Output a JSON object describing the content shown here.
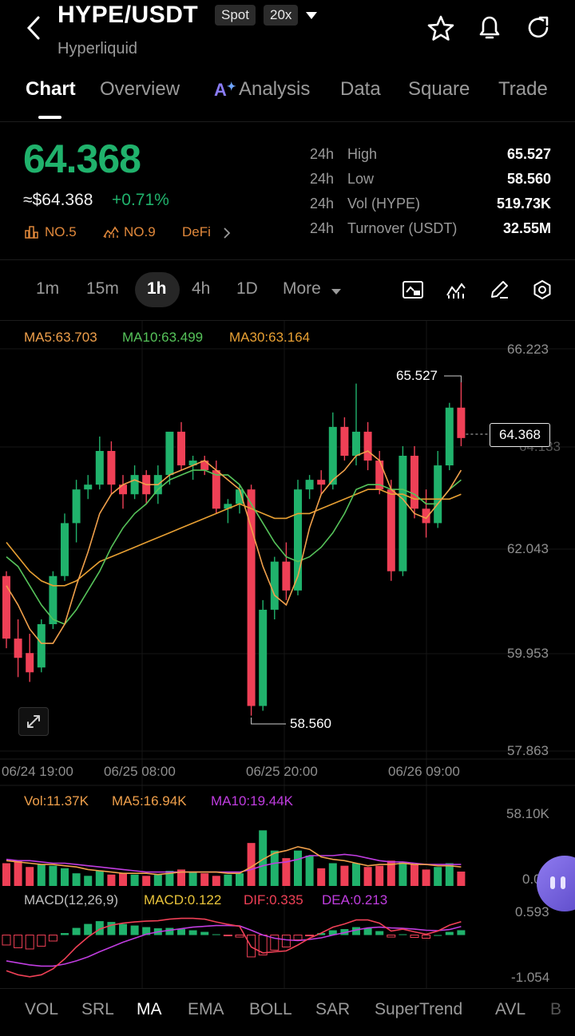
{
  "header": {
    "title": "HYPE/USDT",
    "spot_badge": "Spot",
    "leverage_badge": "20x",
    "subtitle": "Hyperliquid"
  },
  "tabs": [
    {
      "label": "Chart"
    },
    {
      "label": "Overview"
    },
    {
      "label": "Analysis"
    },
    {
      "label": "Data"
    },
    {
      "label": "Square"
    },
    {
      "label": "Trade"
    }
  ],
  "ticker": {
    "price": "64.368",
    "approx": "≈$64.368",
    "change": "+0.71%",
    "rank1": "NO.5",
    "rank2": "NO.9",
    "category": "DeFi",
    "stats": [
      {
        "period": "24h",
        "label": "High",
        "value": "65.527"
      },
      {
        "period": "24h",
        "label": "Low",
        "value": "58.560"
      },
      {
        "period": "24h",
        "label": "Vol (HYPE)",
        "value": "519.73K"
      },
      {
        "period": "24h",
        "label": "Turnover (USDT)",
        "value": "32.55M"
      }
    ]
  },
  "timeframes": [
    {
      "label": "1m"
    },
    {
      "label": "15m"
    },
    {
      "label": "1h"
    },
    {
      "label": "4h"
    },
    {
      "label": "1D"
    },
    {
      "label": "More"
    }
  ],
  "ma_legend": {
    "ma5": "MA5:63.703",
    "ma10": "MA10:63.499",
    "ma30": "MA30:63.164"
  },
  "price_axis": [
    "66.223",
    "62.043",
    "59.953",
    "57.863"
  ],
  "time_axis": [
    "06/24 19:00",
    "06/25 08:00",
    "06/25 20:00",
    "06/26 09:00"
  ],
  "annotations": {
    "high": "65.527",
    "low": "58.560",
    "current": "64.368",
    "hidden_tick": "64.133"
  },
  "vol_legend": {
    "vol": "Vol:11.37K",
    "ma5": "MA5:16.94K",
    "ma10": "MA10:19.44K"
  },
  "vol_axis": {
    "top": "58.10K",
    "bottom": "0.00"
  },
  "macd_legend": {
    "name": "MACD(12,26,9)",
    "macd": "MACD:0.122",
    "dif": "DIF:0.335",
    "dea": "DEA:0.213"
  },
  "macd_axis": {
    "top": "0.593",
    "bottom": "-1.054"
  },
  "indicator_tabs": [
    {
      "label": "VOL"
    },
    {
      "label": "SRL"
    },
    {
      "label": "MA"
    },
    {
      "label": "EMA"
    },
    {
      "label": "BOLL"
    },
    {
      "label": "SAR"
    },
    {
      "label": "SuperTrend"
    },
    {
      "label": "AVL"
    },
    {
      "label": "B"
    }
  ],
  "colors": {
    "up": "#20b26c",
    "down": "#ef4056",
    "ma5": "#f0a04b",
    "ma10": "#56c35a",
    "ma30": "#e8a033",
    "dea": "#c03de0"
  },
  "chart_data": {
    "type": "candlestick",
    "y_range": [
      57.863,
      66.223
    ],
    "candles": [
      {
        "o": 61.5,
        "h": 61.6,
        "l": 60.0,
        "c": 60.2
      },
      {
        "o": 60.2,
        "h": 60.6,
        "l": 59.4,
        "c": 59.8
      },
      {
        "o": 59.9,
        "h": 60.3,
        "l": 59.3,
        "c": 59.5
      },
      {
        "o": 59.6,
        "h": 60.6,
        "l": 59.5,
        "c": 60.5
      },
      {
        "o": 60.5,
        "h": 61.6,
        "l": 60.4,
        "c": 61.5
      },
      {
        "o": 61.5,
        "h": 62.8,
        "l": 61.4,
        "c": 62.6
      },
      {
        "o": 62.6,
        "h": 63.5,
        "l": 62.2,
        "c": 63.3
      },
      {
        "o": 63.3,
        "h": 63.6,
        "l": 63.1,
        "c": 63.4
      },
      {
        "o": 63.4,
        "h": 64.4,
        "l": 63.3,
        "c": 64.1
      },
      {
        "o": 64.1,
        "h": 64.3,
        "l": 63.2,
        "c": 63.4
      },
      {
        "o": 63.4,
        "h": 63.6,
        "l": 62.9,
        "c": 63.2
      },
      {
        "o": 63.2,
        "h": 63.8,
        "l": 63.1,
        "c": 63.6
      },
      {
        "o": 63.6,
        "h": 63.7,
        "l": 63.0,
        "c": 63.2
      },
      {
        "o": 63.2,
        "h": 63.8,
        "l": 63.0,
        "c": 63.6
      },
      {
        "o": 63.6,
        "h": 64.3,
        "l": 63.4,
        "c": 64.5
      },
      {
        "o": 64.5,
        "h": 64.7,
        "l": 63.7,
        "c": 63.8
      },
      {
        "o": 63.8,
        "h": 64.0,
        "l": 63.5,
        "c": 63.9
      },
      {
        "o": 63.9,
        "h": 64.0,
        "l": 63.6,
        "c": 63.7
      },
      {
        "o": 63.7,
        "h": 63.9,
        "l": 62.8,
        "c": 62.9
      },
      {
        "o": 62.9,
        "h": 63.1,
        "l": 62.6,
        "c": 63.0
      },
      {
        "o": 63.0,
        "h": 63.4,
        "l": 62.8,
        "c": 63.3
      },
      {
        "o": 63.3,
        "h": 63.4,
        "l": 58.6,
        "c": 58.8
      },
      {
        "o": 58.8,
        "h": 61.0,
        "l": 58.7,
        "c": 60.8
      },
      {
        "o": 60.8,
        "h": 61.9,
        "l": 60.6,
        "c": 61.8
      },
      {
        "o": 61.8,
        "h": 62.2,
        "l": 61.0,
        "c": 61.2
      },
      {
        "o": 61.2,
        "h": 63.5,
        "l": 61.1,
        "c": 63.3
      },
      {
        "o": 63.3,
        "h": 63.6,
        "l": 63.1,
        "c": 63.5
      },
      {
        "o": 63.5,
        "h": 63.7,
        "l": 63.2,
        "c": 63.4
      },
      {
        "o": 63.4,
        "h": 64.9,
        "l": 63.3,
        "c": 64.6
      },
      {
        "o": 64.6,
        "h": 64.8,
        "l": 63.9,
        "c": 64.0
      },
      {
        "o": 64.0,
        "h": 65.5,
        "l": 63.8,
        "c": 64.5
      },
      {
        "o": 64.5,
        "h": 64.7,
        "l": 63.7,
        "c": 63.9
      },
      {
        "o": 63.9,
        "h": 64.1,
        "l": 63.2,
        "c": 63.3
      },
      {
        "o": 63.3,
        "h": 63.5,
        "l": 61.4,
        "c": 61.6
      },
      {
        "o": 61.6,
        "h": 64.2,
        "l": 61.5,
        "c": 64.0
      },
      {
        "o": 64.0,
        "h": 64.2,
        "l": 62.7,
        "c": 62.9
      },
      {
        "o": 62.9,
        "h": 63.3,
        "l": 62.3,
        "c": 62.6
      },
      {
        "o": 62.6,
        "h": 64.1,
        "l": 62.5,
        "c": 63.8
      },
      {
        "o": 63.8,
        "h": 65.1,
        "l": 63.7,
        "c": 65.0
      },
      {
        "o": 65.0,
        "h": 65.527,
        "l": 64.2,
        "c": 64.368
      }
    ],
    "ma5": [
      61.3,
      60.9,
      60.4,
      60.1,
      60.1,
      60.5,
      61.3,
      62.0,
      62.8,
      63.2,
      63.4,
      63.5,
      63.4,
      63.4,
      63.6,
      63.7,
      63.8,
      63.9,
      63.7,
      63.5,
      63.3,
      62.5,
      61.7,
      61.1,
      60.9,
      61.5,
      62.5,
      63.2,
      63.5,
      63.7,
      64.0,
      64.1,
      63.9,
      63.3,
      63.1,
      62.8,
      62.7,
      63.0,
      63.3,
      63.7
    ],
    "ma10": [
      61.9,
      61.7,
      61.3,
      60.9,
      60.6,
      60.5,
      60.8,
      61.2,
      61.6,
      62.1,
      62.5,
      62.8,
      63.0,
      63.3,
      63.5,
      63.6,
      63.7,
      63.7,
      63.6,
      63.6,
      63.4,
      63.0,
      62.6,
      62.2,
      61.9,
      61.8,
      61.9,
      62.1,
      62.4,
      62.8,
      63.3,
      63.4,
      63.4,
      63.3,
      63.3,
      63.2,
      63.0,
      63.0,
      63.3,
      63.5
    ],
    "ma30": [
      62.2,
      61.9,
      61.6,
      61.4,
      61.3,
      61.3,
      61.4,
      61.6,
      61.8,
      61.9,
      62.0,
      62.1,
      62.2,
      62.3,
      62.4,
      62.5,
      62.6,
      62.7,
      62.8,
      62.9,
      63.0,
      62.9,
      62.8,
      62.7,
      62.7,
      62.8,
      62.8,
      62.9,
      63.0,
      63.1,
      63.2,
      63.3,
      63.3,
      63.2,
      63.2,
      63.1,
      63.1,
      63.1,
      63.1,
      63.2
    ],
    "volume": [
      18,
      20,
      15,
      17,
      16,
      14,
      10,
      8,
      12,
      9,
      10,
      9,
      8,
      9,
      12,
      13,
      11,
      10,
      8,
      9,
      10,
      34,
      44,
      28,
      22,
      28,
      24,
      14,
      18,
      16,
      18,
      15,
      16,
      20,
      19,
      17,
      13,
      15,
      18,
      11.37
    ],
    "vol_ma5": [
      20,
      19,
      18,
      17,
      17,
      16,
      15,
      13,
      12,
      11,
      10,
      10,
      10,
      9,
      10,
      11,
      11,
      11,
      11,
      10,
      10,
      15,
      21,
      26,
      28,
      31,
      29,
      23,
      21,
      20,
      18,
      16,
      17,
      17,
      18,
      17,
      17,
      16,
      16,
      15
    ],
    "vol_ma10": [
      21,
      20,
      20,
      19,
      18,
      18,
      17,
      16,
      15,
      14,
      13,
      12,
      11,
      11,
      11,
      11,
      11,
      11,
      11,
      11,
      11,
      13,
      16,
      18,
      19,
      21,
      24,
      24,
      24,
      25,
      24,
      22,
      20,
      19,
      19,
      18,
      17,
      17,
      17,
      17
    ],
    "macd_hist": [
      -0.25,
      -0.32,
      -0.35,
      -0.28,
      -0.15,
      0.05,
      0.18,
      0.28,
      0.35,
      0.33,
      0.28,
      0.24,
      0.2,
      0.17,
      0.18,
      0.15,
      0.12,
      0.08,
      0.02,
      -0.02,
      -0.05,
      -0.55,
      -0.5,
      -0.38,
      -0.3,
      -0.12,
      -0.02,
      0.05,
      0.12,
      0.15,
      0.2,
      0.18,
      0.1,
      -0.05,
      0.02,
      -0.06,
      -0.08,
      0.0,
      0.08,
      0.122
    ],
    "dif": [
      -0.9,
      -1.0,
      -1.05,
      -1.0,
      -0.85,
      -0.6,
      -0.3,
      -0.05,
      0.15,
      0.25,
      0.3,
      0.33,
      0.35,
      0.36,
      0.4,
      0.42,
      0.42,
      0.4,
      0.33,
      0.27,
      0.22,
      -0.3,
      -0.45,
      -0.42,
      -0.4,
      -0.25,
      -0.08,
      0.05,
      0.2,
      0.28,
      0.38,
      0.38,
      0.3,
      0.1,
      0.15,
      0.08,
      0.02,
      0.1,
      0.25,
      0.335
    ],
    "dea": [
      -0.65,
      -0.7,
      -0.75,
      -0.78,
      -0.78,
      -0.73,
      -0.65,
      -0.55,
      -0.42,
      -0.3,
      -0.18,
      -0.08,
      0.02,
      0.08,
      0.12,
      0.16,
      0.2,
      0.22,
      0.24,
      0.24,
      0.23,
      0.12,
      0.0,
      -0.08,
      -0.12,
      -0.14,
      -0.11,
      -0.07,
      0.0,
      0.06,
      0.13,
      0.18,
      0.2,
      0.18,
      0.17,
      0.15,
      0.12,
      0.11,
      0.14,
      0.213
    ]
  }
}
